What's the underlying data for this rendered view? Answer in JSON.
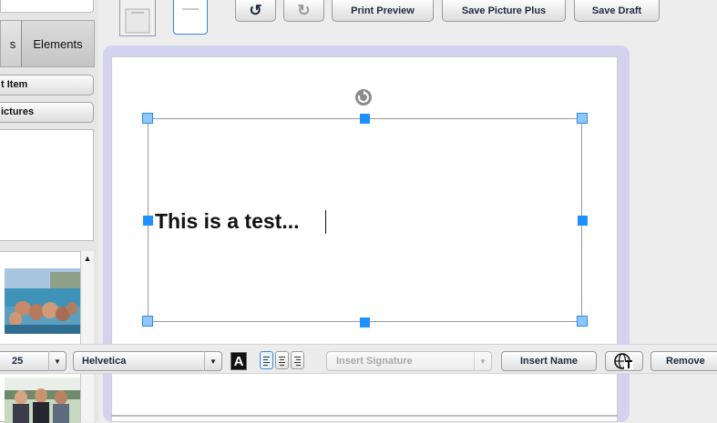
{
  "left_panel": {
    "tab_left_label": "s",
    "tab_elements_label": "Elements",
    "btn_insert_item_label": "t Item",
    "btn_pictures_label": "ictures",
    "scroll_up_glyph": "▲"
  },
  "toolbar": {
    "undo_glyph": "↺",
    "redo_glyph": "↻",
    "print_preview_label": "Print Preview",
    "save_picture_plus_label": "Save Picture Plus",
    "save_draft_label": "Save Draft"
  },
  "canvas": {
    "text_content": "This is a test..."
  },
  "format_bar": {
    "font_size_value": "25",
    "font_family_value": "Helvetica",
    "color_swatch_label": "A",
    "insert_signature_placeholder": "Insert Signature",
    "insert_name_label": "Insert Name",
    "remove_label": "Remove",
    "dropdown_glyph": "▼",
    "active_alignment": "left"
  },
  "colors": {
    "accent_blue": "#1e90ff",
    "canvas_frame": "#d4d2ef"
  }
}
